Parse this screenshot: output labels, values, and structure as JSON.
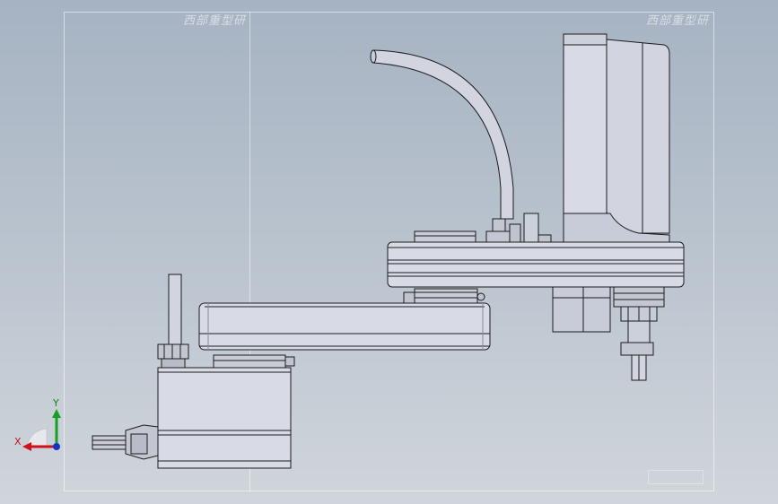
{
  "viewport": {
    "watermark_left": "西部重型研",
    "watermark_right": "西部重型研"
  },
  "triad": {
    "x_label": "X",
    "y_label": "Y",
    "x_color": "#d0121a",
    "y_color": "#14a020",
    "z_color": "#1432c8"
  },
  "model": {
    "body_fill": "#d8dbe6",
    "shade_fill": "#c2c6d3",
    "outline": "#1c1c1c"
  }
}
